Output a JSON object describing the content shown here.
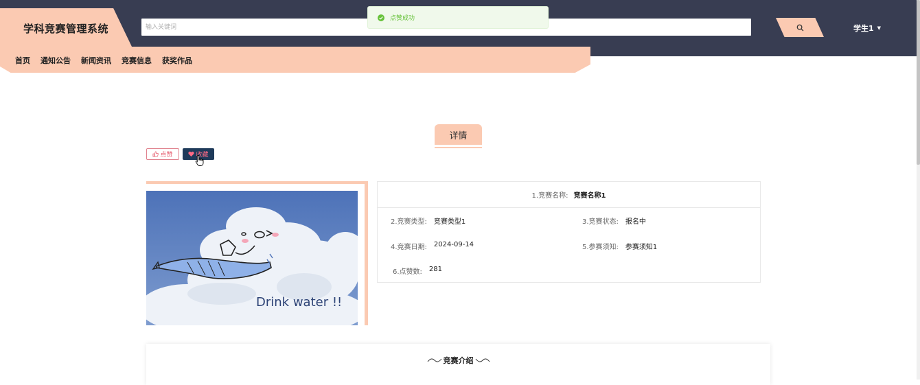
{
  "header": {
    "site_title": "学科竞赛管理系统",
    "search_placeholder": "输入关键词",
    "user_name": "学生1"
  },
  "nav": {
    "items": [
      "首页",
      "通知公告",
      "新闻资讯",
      "竞赛信息",
      "获奖作品"
    ]
  },
  "toast": {
    "message": "点赞成功"
  },
  "detail": {
    "tab_label": "详情",
    "like_label": "点赞",
    "favorite_label": "收藏",
    "fields": [
      {
        "label": "1.竞赛名称:",
        "value": "竞赛名称1"
      },
      {
        "label": "2.竞赛类型:",
        "value": "竞赛类型1"
      },
      {
        "label": "3.竞赛状态:",
        "value": "报名中"
      },
      {
        "label": "4.竞赛日期:",
        "value": "2024-09-14"
      },
      {
        "label": "5.参赛须知:",
        "value": "参赛须知1"
      },
      {
        "label": "6.点赞数:",
        "value": "281"
      }
    ],
    "image_caption": "Drink water !!"
  },
  "intro": {
    "title": "竞赛介绍"
  },
  "colors": {
    "topbar": "#383d52",
    "accent": "#fbcab2",
    "toast_bg": "#f0f9eb",
    "toast_text": "#67c23a",
    "favorite_bg": "#1e3a5a"
  }
}
